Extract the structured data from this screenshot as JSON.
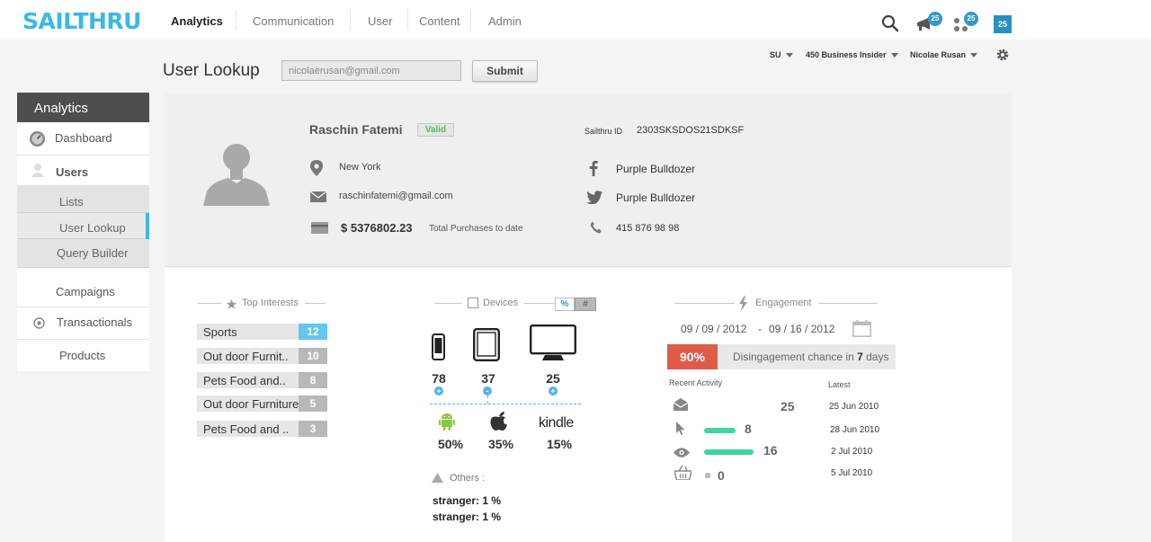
{
  "header": {
    "logo": "SAILTHRU",
    "nav": [
      "Analytics",
      "Communication",
      "User",
      "Content",
      "Admin"
    ],
    "badges": {
      "megaphone": "25",
      "apps": "25",
      "square": "25"
    }
  },
  "subheader": {
    "title": "User Lookup",
    "search_value": "nicolaerusan@gmail.com",
    "submit_label": "Submit",
    "ctx_su": "SU",
    "ctx_client": "450 Business Insider",
    "ctx_user": "Nicolae Rusan"
  },
  "sidebar": {
    "header": "Analytics",
    "items": {
      "dashboard": "Dashboard",
      "users": "Users",
      "lists": "Lists",
      "user_lookup": "User Lookup",
      "query_builder": "Query Builder",
      "campaigns": "Campaigns",
      "transactionals": "Transactionals",
      "products": "Products"
    }
  },
  "profile": {
    "name": "Raschin Fatemi",
    "status": "Valid",
    "sailthru_id_label": "Sailthru ID",
    "sailthru_id": "2303SKSDOS21SDKSF",
    "location": "New York",
    "email": "raschinfatemi@gmail.com",
    "purchases": "$ 5376802.23",
    "purchases_label": "Total Purchases to date",
    "facebook": "Purple Bulldozer",
    "twitter": "Purple Bulldozer",
    "phone": "415 876 98 98"
  },
  "interests": {
    "title": "Top Interests",
    "items": [
      {
        "label": "Sports",
        "count": "12"
      },
      {
        "label": "Out door Furnit..",
        "count": "10"
      },
      {
        "label": "Pets Food and..",
        "count": "8"
      },
      {
        "label": "Out door Furniture",
        "count": "5"
      },
      {
        "label": "Pets Food and ..",
        "count": "3"
      }
    ]
  },
  "devices": {
    "title": "Devices",
    "toggle_pct": "%",
    "toggle_num": "#",
    "counts": {
      "phone": "78",
      "tablet": "37",
      "desktop": "25"
    },
    "platforms": {
      "android": "50%",
      "apple": "35%",
      "kindle": "15%"
    },
    "kindle_label": "kindle",
    "others_label": "Others :",
    "others": [
      "stranger: 1 %",
      "stranger: 1 %"
    ]
  },
  "engagement": {
    "title": "Engagement",
    "date_from": "09 / 09 / 2012",
    "date_sep": "-",
    "date_to": "09 / 16 /  2012",
    "chance_pct": "90%",
    "chance_text_pre": "Disingagement chance in ",
    "chance_days": "7",
    "chance_text_post": " days",
    "recent_label": "Recent Activity",
    "latest_label": "Latest",
    "activity": [
      {
        "icon": "envelope-icon",
        "value": "25",
        "level": 0,
        "date": "25 Jun 2010"
      },
      {
        "icon": "cursor-icon",
        "value": "8",
        "level": 0.3,
        "date": "28 Jun 2010"
      },
      {
        "icon": "eye-icon",
        "value": "16",
        "level": 0.55,
        "date": "2   Jul 2010"
      },
      {
        "icon": "basket-icon",
        "value": "0",
        "level": 0.05,
        "date": "5   Jul 2010"
      }
    ]
  },
  "colors": {
    "brand": "#3bb8e6",
    "accent_red": "#e05a4a",
    "bar_green": "#3fd4a2",
    "sidebar_head": "#4d4e50"
  }
}
